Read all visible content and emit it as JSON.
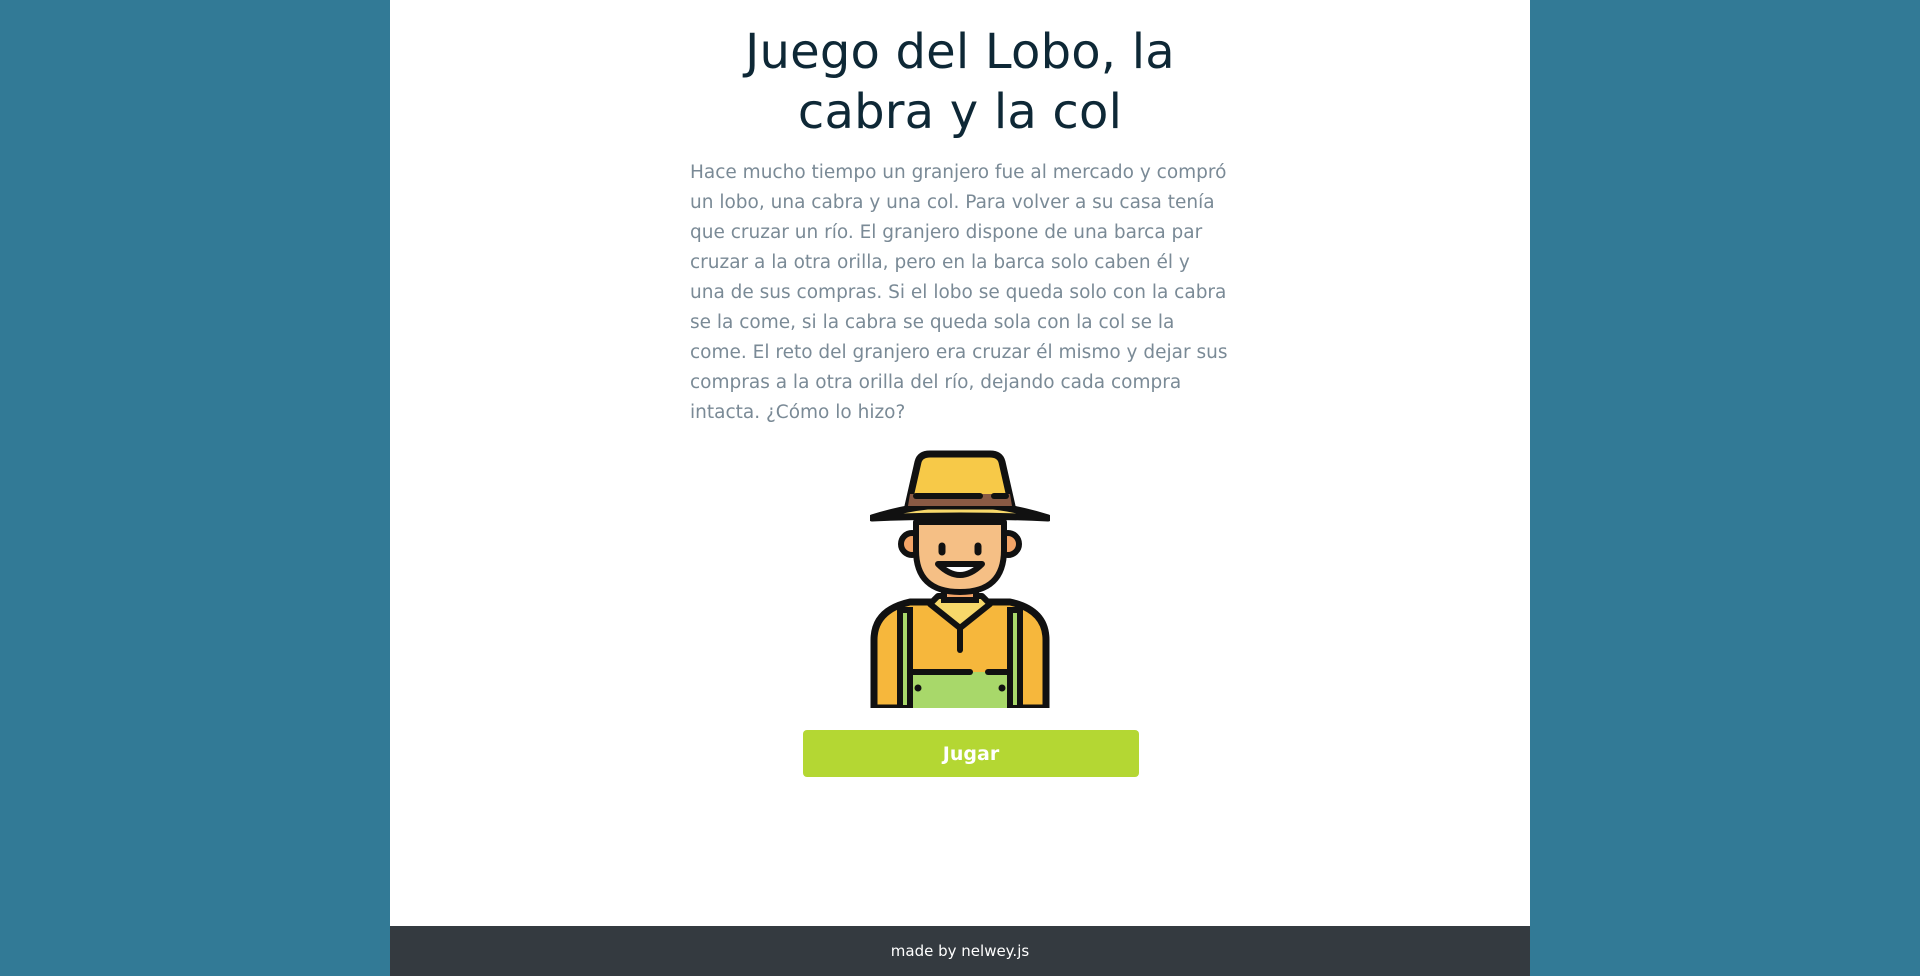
{
  "game": {
    "title": "Juego del Lobo, la cabra y la col",
    "description": "Hace mucho tiempo un granjero fue al mercado y compró un lobo, una cabra y una col. Para volver a su casa tenía que cruzar un río. El granjero dispone de una barca par cruzar a la otra orilla, pero en la barca solo caben él y una de sus compras. Si el lobo se queda solo con la cabra se la come, si la cabra se queda sola con la col se la come. El reto del granjero era cruzar él mismo y dejar sus compras a la otra orilla del río, dejando cada compra intacta. ¿Cómo lo hizo?",
    "illustration_icon": "farmer-icon",
    "play_label": "Jugar"
  },
  "footer": {
    "credit": "made by nelwey.js"
  },
  "colors": {
    "background": "#327a96",
    "panel": "#ffffff",
    "title": "#0e2836",
    "text": "#7a8a96",
    "button": "#b4d733",
    "footer": "#343a40"
  }
}
